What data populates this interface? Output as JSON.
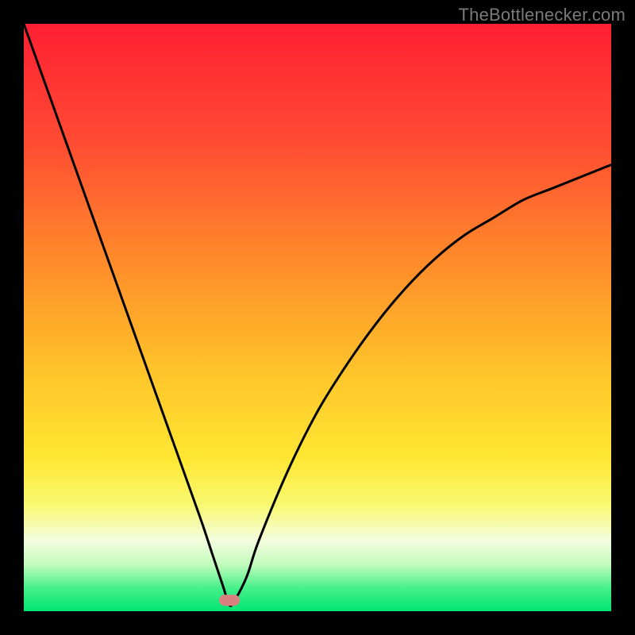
{
  "watermark": "TheBottlenecker.com",
  "chart_data": {
    "type": "line",
    "title": "",
    "xlabel": "",
    "ylabel": "",
    "xlim": [
      0,
      100
    ],
    "ylim": [
      0,
      100
    ],
    "series": [
      {
        "name": "bottleneck-curve",
        "x": [
          0,
          5,
          10,
          15,
          20,
          25,
          30,
          32,
          34,
          35,
          36,
          38,
          40,
          45,
          50,
          55,
          60,
          65,
          70,
          75,
          80,
          85,
          90,
          95,
          100
        ],
        "values": [
          100,
          86,
          72,
          58,
          44,
          30,
          16,
          10,
          4,
          1,
          2,
          6,
          12,
          24,
          34,
          42,
          49,
          55,
          60,
          64,
          67,
          70,
          72,
          74,
          76
        ]
      }
    ],
    "marker": {
      "x": 35,
      "y": 2,
      "color": "#d9817e"
    },
    "gradient_stops": [
      {
        "offset": 0.0,
        "color": "#ff1f33"
      },
      {
        "offset": 0.2,
        "color": "#ff4b33"
      },
      {
        "offset": 0.4,
        "color": "#ff8a2a"
      },
      {
        "offset": 0.6,
        "color": "#ffc62a"
      },
      {
        "offset": 0.74,
        "color": "#ffe733"
      },
      {
        "offset": 0.82,
        "color": "#f9f972"
      },
      {
        "offset": 0.88,
        "color": "#f4fde0"
      },
      {
        "offset": 0.92,
        "color": "#c3fcbd"
      },
      {
        "offset": 0.96,
        "color": "#48f08a"
      },
      {
        "offset": 1.0,
        "color": "#00e573"
      }
    ]
  }
}
